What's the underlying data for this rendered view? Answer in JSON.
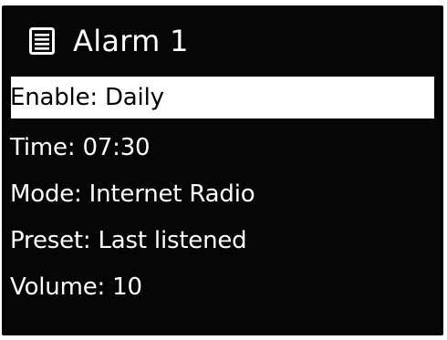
{
  "header": {
    "title": "Alarm 1",
    "icon": "list-icon"
  },
  "menu": {
    "items": [
      {
        "label": "Enable: Daily",
        "selected": true
      },
      {
        "label": "Time: 07:30",
        "selected": false
      },
      {
        "label": "Mode: Internet Radio",
        "selected": false
      },
      {
        "label": "Preset: Last listened",
        "selected": false
      },
      {
        "label": "Volume: 10",
        "selected": false
      }
    ]
  },
  "colors": {
    "background": "#050505",
    "text": "#ffffff",
    "highlight": "#ffffff",
    "highlight_text": "#000000"
  }
}
